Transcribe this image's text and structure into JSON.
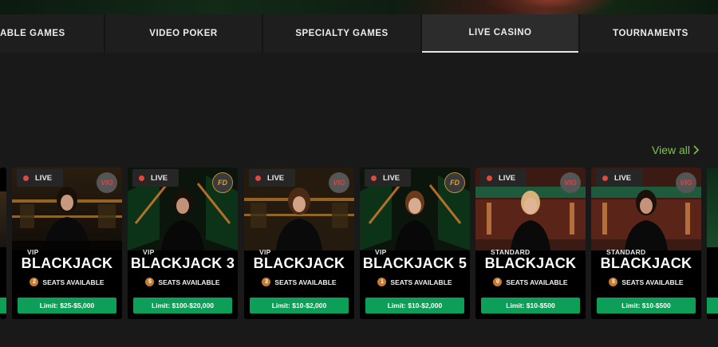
{
  "nav": {
    "tabs": [
      {
        "label": "ABLE GAMES",
        "active": false
      },
      {
        "label": "VIDEO POKER",
        "active": false
      },
      {
        "label": "SPECIALTY GAMES",
        "active": false
      },
      {
        "label": "LIVE CASINO",
        "active": true
      },
      {
        "label": "TOURNAMENTS",
        "active": false
      }
    ]
  },
  "view_all": {
    "label": "View all",
    "color": "#7fc24a"
  },
  "colors": {
    "limit_button": "#0d9e57",
    "live_dot": "#e0493f",
    "seat_badge": "#c97a2c"
  },
  "cards": [
    {
      "badge": "LIVE",
      "provider_icon": "vig-logo-icon",
      "tier": "VIP",
      "title": "BLACKJACK",
      "seats": "2",
      "seats_label": "SEATS AVAILABLE",
      "limit": "Limit: $25-$5,000"
    },
    {
      "badge": "LIVE",
      "provider_icon": "fd-logo-icon",
      "tier": "VIP",
      "title": "BLACKJACK 3",
      "seats": "5",
      "seats_label": "SEATS AVAILABLE",
      "limit": "Limit: $100-$20,000"
    },
    {
      "badge": "LIVE",
      "provider_icon": "vig-logo-icon",
      "tier": "VIP",
      "title": "BLACKJACK",
      "seats": "3",
      "seats_label": "SEATS AVAILABLE",
      "limit": "Limit: $10-$2,000"
    },
    {
      "badge": "LIVE",
      "provider_icon": "fd-logo-icon",
      "tier": "VIP",
      "title": "BLACKJACK 5",
      "seats": "1",
      "seats_label": "SEATS AVAILABLE",
      "limit": "Limit: $10-$2,000"
    },
    {
      "badge": "LIVE",
      "provider_icon": "vig-logo-icon",
      "tier": "STANDARD",
      "title": "BLACKJACK",
      "seats": "0",
      "seats_label": "SEATS AVAILABLE",
      "limit": "Limit: $10-$500"
    },
    {
      "badge": "LIVE",
      "provider_icon": "vig-logo-icon",
      "tier": "STANDARD",
      "title": "BLACKJACK",
      "seats": "5",
      "seats_label": "SEATS AVAILABLE",
      "limit": "Limit: $10-$500"
    }
  ]
}
